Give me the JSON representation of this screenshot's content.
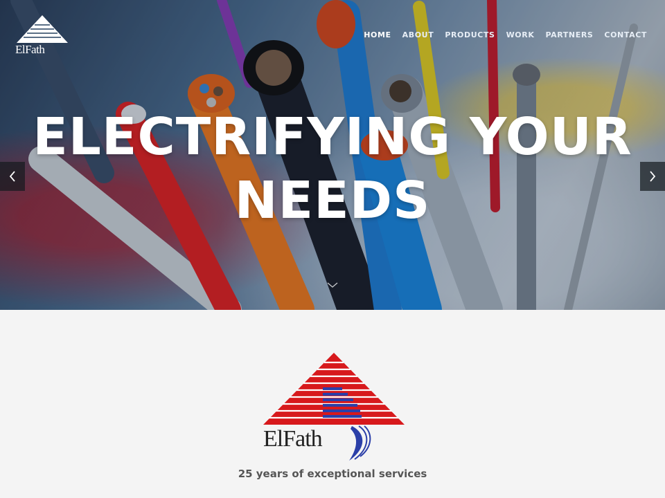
{
  "header": {
    "brand": "ElFath",
    "nav": [
      {
        "label": "HOME",
        "active": true
      },
      {
        "label": "ABOUT"
      },
      {
        "label": "PRODUCTS"
      },
      {
        "label": "WORK"
      },
      {
        "label": "PARTNERS"
      },
      {
        "label": "CONTACT"
      }
    ]
  },
  "hero": {
    "headline_line1": "ELECTRIFYING YOUR",
    "headline_line2": "NEEDS",
    "prev_icon": "chevron-left-icon",
    "next_icon": "chevron-right-icon",
    "scroll_icon": "chevron-down-icon"
  },
  "intro": {
    "brand": "ElFath",
    "tagline": "25 years of exceptional services"
  },
  "colors": {
    "logo_red": "#d7191c",
    "logo_blue": "#2b3fa8",
    "tagline": "#555555",
    "intro_bg": "#f4f4f4"
  }
}
